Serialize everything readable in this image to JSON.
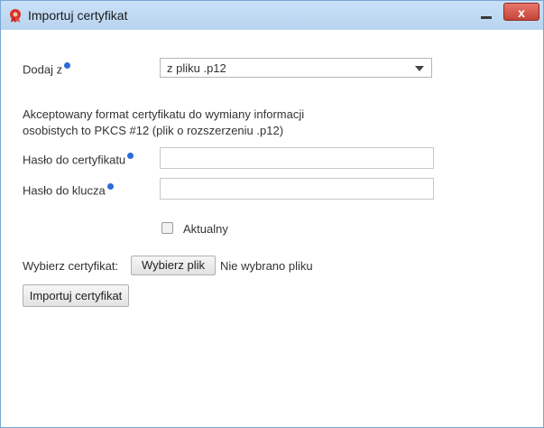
{
  "window": {
    "title": "Importuj certyfikat",
    "close_label": "x"
  },
  "form": {
    "source_label": "Dodaj z",
    "source_value": "z pliku .p12",
    "description_line1": "Akceptowany format certyfikatu do wymiany informacji",
    "description_line2": "osobistych to PKCS #12 (plik o rozszerzeniu .p12)",
    "cert_password_label": "Hasło do certyfikatu",
    "cert_password_value": "",
    "key_password_label": "Hasło do klucza",
    "key_password_value": "",
    "current_label": "Aktualny",
    "current_checked": false,
    "choose_cert_label": "Wybierz certyfikat:",
    "choose_file_button": "Wybierz plik",
    "no_file_text": "Nie wybrano pliku",
    "import_button": "Importuj certyfikat"
  },
  "colors": {
    "titlebar": "#bcd6f1",
    "close_button": "#d2574b",
    "info_icon": "#2a6bd8"
  },
  "icons": {
    "app": "red-gear-icon",
    "info": "info-icon",
    "dropdown": "chevron-down-icon"
  }
}
